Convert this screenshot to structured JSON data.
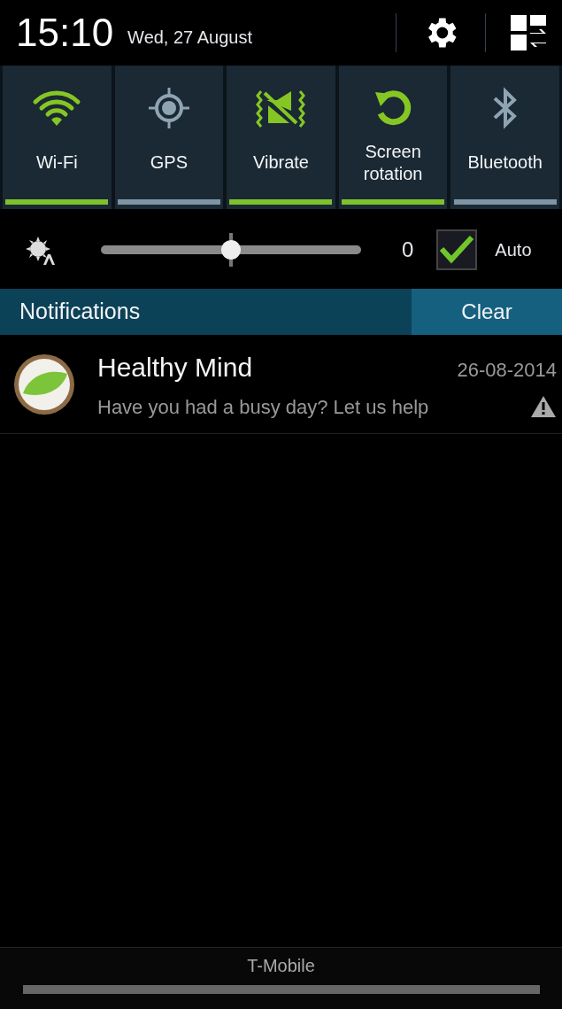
{
  "status": {
    "time": "15:10",
    "date": "Wed, 27 August"
  },
  "toggles": [
    {
      "kind": "wifi",
      "label": "Wi-Fi",
      "on": true
    },
    {
      "kind": "gps",
      "label": "GPS",
      "on": false
    },
    {
      "kind": "vibrate",
      "label": "Vibrate",
      "on": true
    },
    {
      "kind": "rotation",
      "label": "Screen rotation",
      "on": true
    },
    {
      "kind": "bluetooth",
      "label": "Bluetooth",
      "on": false
    }
  ],
  "brightness": {
    "level": 0.5,
    "reading": "0",
    "auto": {
      "label": "Auto",
      "checked": true
    }
  },
  "notifications": {
    "title": "Notifications",
    "clear": "Clear",
    "items": [
      {
        "title": "Healthy Mind",
        "time": "26-08-2014",
        "text": "Have you had a busy day? Let us help"
      }
    ]
  },
  "carrier": "T-Mobile"
}
